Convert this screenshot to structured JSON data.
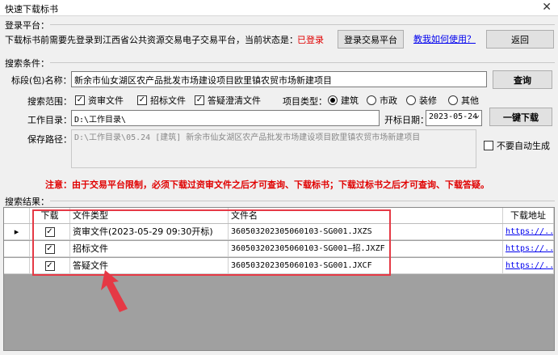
{
  "window": {
    "title": "快速下载标书",
    "close_glyph": "✕"
  },
  "login": {
    "group_label": "登录平台：",
    "notice": "下载标书前需要先登录到江西省公共资源交易电子交易平台，当前状态是：",
    "status": "已登录",
    "login_button": "登录交易平台",
    "help_link": "教我如何使用？",
    "back_button": "返回",
    "status_color": "#e00000"
  },
  "search": {
    "group_label": "搜索条件：",
    "section_name_label": "标段(包)名称：",
    "section_name_value": "新余市仙女湖区农产品批发市场建设项目欧里镇农贸市场新建项目",
    "query_button": "查询",
    "scope_label": "搜索范围：",
    "scope_options": [
      {
        "label": "资审文件",
        "checked": "✓"
      },
      {
        "label": "招标文件",
        "checked": "✓"
      },
      {
        "label": "答疑澄清文件",
        "checked": "✓"
      }
    ],
    "project_type_label": "项目类型：",
    "project_types": [
      {
        "label": "建筑",
        "selected": true
      },
      {
        "label": "市政",
        "selected": false
      },
      {
        "label": "装修",
        "selected": false
      },
      {
        "label": "其他",
        "selected": false
      }
    ],
    "workdir_label": "工作目录：",
    "workdir_value": "D:\\工作目录\\",
    "open_date_label": "开标日期：",
    "open_date_value": "2023-05-24",
    "dropdown_glyph": "⌄",
    "download_button": "一键下载",
    "save_path_label": "保存路径：",
    "save_path_value": "D:\\工作目录\\05.24 [建筑] 新余市仙女湖区农产品批发市场建设项目欧里镇农贸市场新建项目",
    "no_auto_label": "不要自动生成",
    "warning": "注意：由于交易平台限制，必须下载过资审文件之后才可查询、下载标书；下载过标书之后才可查询、下载答疑。"
  },
  "results": {
    "group_label": "搜索结果：",
    "columns": [
      "下载",
      "文件类型",
      "文件名",
      "下载地址"
    ],
    "row_marker": "▸",
    "rows": [
      {
        "checked": "✓",
        "type": "资审文件(2023-05-29 09:30开标)",
        "filename": "360503202305060103-SG001.JXZS",
        "url": "https://..."
      },
      {
        "checked": "✓",
        "type": "招标文件",
        "filename": "360503202305060103-SG001—招.JXZF",
        "url": "https://..."
      },
      {
        "checked": "✓",
        "type": "答疑文件",
        "filename": "360503202305060103-SG001.JXCF",
        "url": "https://..."
      }
    ]
  },
  "annotation": {
    "color": "#e53945"
  }
}
